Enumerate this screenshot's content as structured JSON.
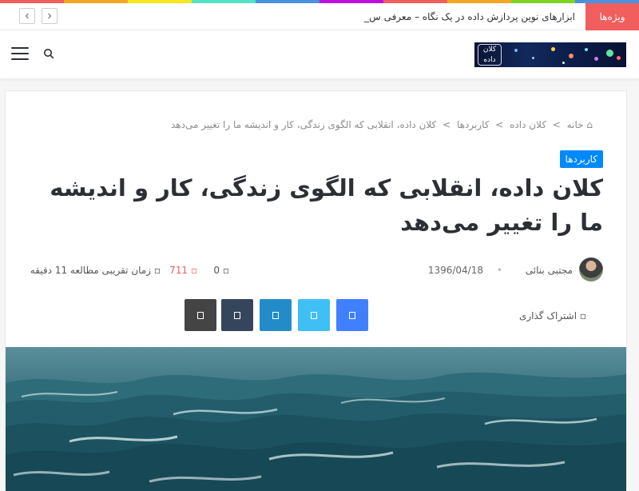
{
  "theme": {
    "rainbow": [
      "#f05e5e",
      "#f5a623",
      "#f8e71c",
      "#50e3c2",
      "#4a90e2",
      "#bd10e0",
      "#f05e5e",
      "#f5a623",
      "#7ed321",
      "#4a90e2"
    ],
    "accent_red": "#f05e5e",
    "category_blue": "#0088ff"
  },
  "topbar": {
    "trending_label": "ویژه‌ها",
    "ticker_text": "ابزارهای نوین پردازش داده در یک نگاه – معرفی س_",
    "prev_icon": "chevron-left-icon",
    "next_icon": "chevron-right-icon"
  },
  "header": {
    "logo_text": "کلان داده",
    "logo_alt": "site-logo",
    "menu_icon": "hamburger-icon",
    "search_icon": "search-icon"
  },
  "article": {
    "breadcrumb": [
      {
        "label": "خانه",
        "icon": "home-icon"
      },
      {
        "label": "کلان داده"
      },
      {
        "label": "کاربردها"
      },
      {
        "label": "کلان داده، انقلابی که الگوی زندگی، کار و اندیشه ما را تغییر می‌دهد"
      }
    ],
    "category": "کاربردها",
    "title": "کلان داده، انقلابی که الگوی زندگی، کار و اندیشه ما را تغییر می‌دهد",
    "author": "مجتبی بنائی",
    "date": "1396/04/18",
    "comments_count": "0",
    "views_count": "711",
    "reading_time": "زمان تقریبی مطالعه 11 دقیقه"
  },
  "share": {
    "label": "اشتراک گذاری",
    "buttons": [
      {
        "name": "facebook",
        "color": "#4080ff"
      },
      {
        "name": "twitter",
        "color": "#40bff5"
      },
      {
        "name": "linkedin",
        "color": "#238cc8"
      },
      {
        "name": "tumblr",
        "color": "#35465c"
      },
      {
        "name": "print",
        "color": "#444444"
      }
    ]
  }
}
